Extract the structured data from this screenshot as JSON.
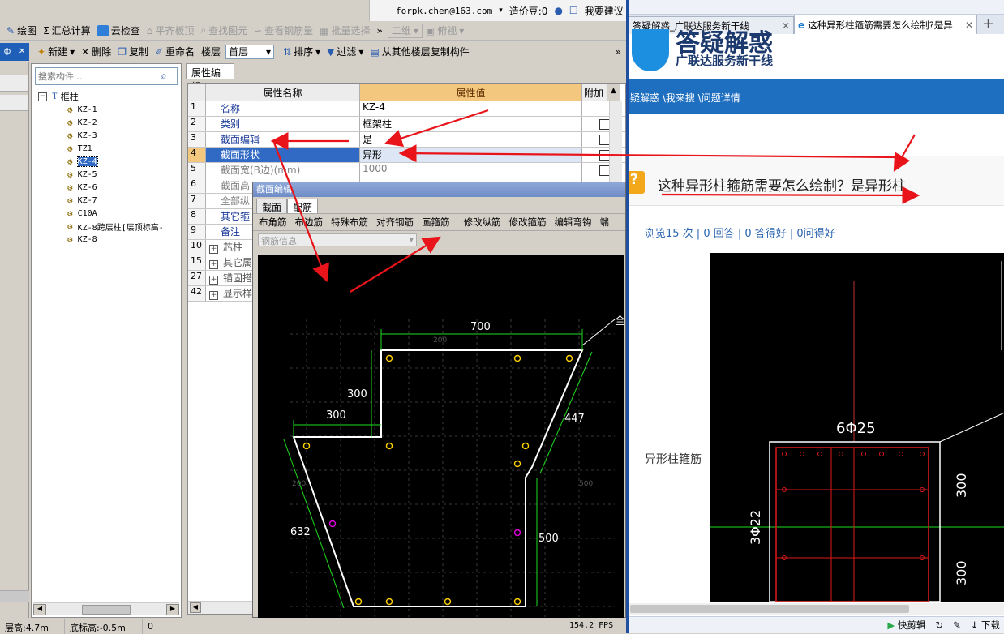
{
  "top_bar": {
    "account": "forpk.chen@163.com",
    "price_label": "造价豆:0",
    "suggest": "我要建议"
  },
  "toolbar1": {
    "draw": "绘图",
    "sum": "汇总计算",
    "cloud_check": "云检查",
    "flat_slab": "平齐板顶",
    "find_element": "查找图元",
    "view_rebar": "查看钢筋量",
    "batch_select": "批量选择",
    "view_mode": "二维",
    "view_angle": "俯视"
  },
  "toolbar2": {
    "new": "新建",
    "delete": "删除",
    "copy": "复制",
    "rename": "重命名",
    "floor_label": "楼层",
    "floor_value": "首层",
    "sort": "排序",
    "filter": "过滤",
    "copy_from_floor": "从其他楼层复制构件"
  },
  "left_panel": {
    "search_placeholder": "搜索构件...",
    "tree_root": "框柱",
    "items": [
      "KZ-1",
      "KZ-2",
      "KZ-3",
      "TZ1",
      "KZ-4",
      "KZ-5",
      "KZ-6",
      "KZ-7",
      "C10A",
      "KZ-8跨层柱[层顶标高-",
      "KZ-8"
    ]
  },
  "property_panel": {
    "tab": "属性编辑",
    "col_name": "属性名称",
    "col_value": "属性值",
    "col_add": "附加",
    "rows": [
      {
        "num": "1",
        "name": "名称",
        "value": "KZ-4"
      },
      {
        "num": "2",
        "name": "类别",
        "value": "框架柱"
      },
      {
        "num": "3",
        "name": "截面编辑",
        "value": "是"
      },
      {
        "num": "4",
        "name": "截面形状",
        "value": "异形"
      },
      {
        "num": "5",
        "name": "截面宽(B边)(mm)",
        "value": "1000"
      },
      {
        "num": "6",
        "name": "截面高",
        "value": ""
      },
      {
        "num": "7",
        "name": "全部纵",
        "value": ""
      },
      {
        "num": "8",
        "name": "其它箍",
        "value": ""
      },
      {
        "num": "9",
        "name": "备注",
        "value": ""
      },
      {
        "num": "10",
        "name": "芯柱",
        "value": ""
      },
      {
        "num": "15",
        "name": "其它属",
        "value": ""
      },
      {
        "num": "27",
        "name": "锚固搭",
        "value": ""
      },
      {
        "num": "42",
        "name": "显示样",
        "value": ""
      }
    ]
  },
  "section_editor": {
    "title": "截面编辑",
    "tabs": [
      "截面",
      "配筋"
    ],
    "tools": [
      "布角筋",
      "布边筋",
      "特殊布筋",
      "对齐钢筋",
      "画箍筋",
      "修改纵筋",
      "修改箍筋",
      "编辑弯钩",
      "端"
    ],
    "rebar_info_placeholder": "钢筋信息",
    "dims": {
      "top": "700",
      "left_upper": "300",
      "left_step": "300",
      "right_slant": "447",
      "left_slant": "632",
      "right_lower": "500",
      "grid_top": "200",
      "grid_left": "200",
      "grid_right": "500",
      "corner_label": "全"
    }
  },
  "status_bar": {
    "floor_height": "层高:4.7m",
    "bottom_elev": "底标高:-0.5m",
    "value": "0",
    "fps": "154.2 FPS"
  },
  "browser": {
    "tabs": [
      {
        "label": "答疑解惑_广联达服务新干线"
      },
      {
        "label": "这种异形柱箍筋需要怎么绘制?是异"
      }
    ],
    "banner_sub": "广联达服务新干线",
    "nav": "疑解惑 \\我来搜 \\问题详情",
    "question_title": "这种异形柱箍筋需要怎么绘制？是异形柱",
    "stats": "浏览15 次 | 0 回答 | 0 答得好 | 0问得好",
    "body_label": "异形柱箍筋",
    "cad": {
      "top_rebar": "6Φ25",
      "side_rebar": "3Φ22",
      "dim_a": "300",
      "dim_b": "300"
    },
    "bottom_tools": [
      "快剪辑",
      "下载"
    ]
  },
  "colors": {
    "arrow": "#e8141a",
    "selected_row": "#316ac5",
    "nav_blue": "#1f6fc0",
    "header_orange": "#f3c77d"
  }
}
